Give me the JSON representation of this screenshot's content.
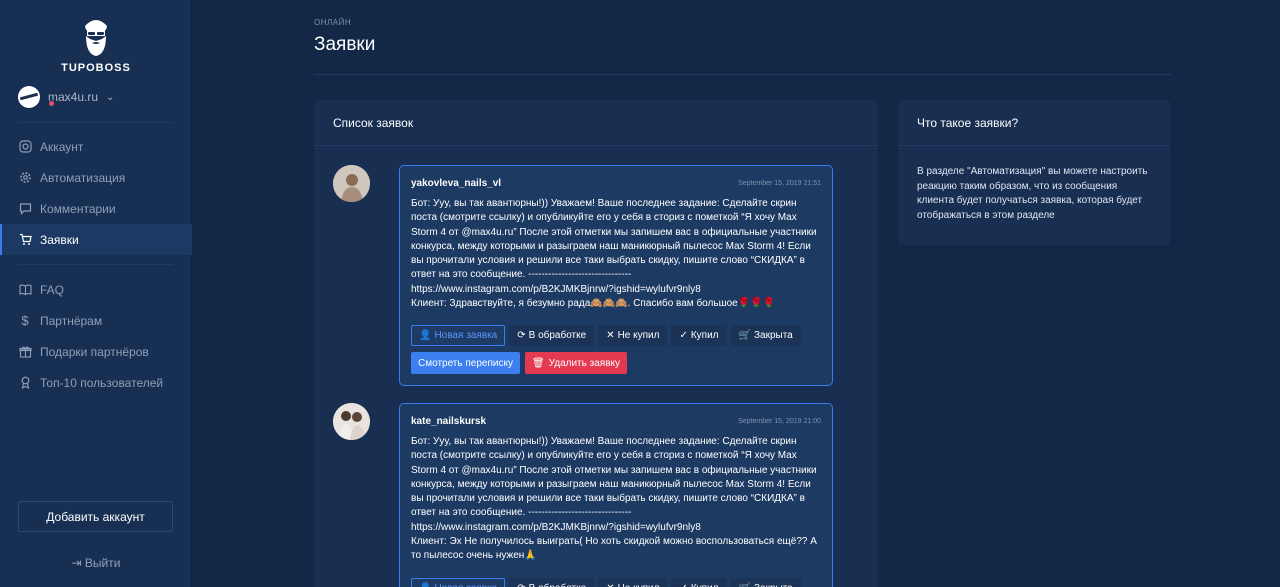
{
  "brand": {
    "name": "TUPOBOSS"
  },
  "account": {
    "name": "max4u.ru"
  },
  "nav": {
    "items": [
      {
        "label": "Аккаунт",
        "icon": "instagram-icon"
      },
      {
        "label": "Автоматизация",
        "icon": "gear-icon"
      },
      {
        "label": "Комментарии",
        "icon": "comment-icon"
      },
      {
        "label": "Заявки",
        "icon": "cart-icon",
        "active": true
      }
    ],
    "items2": [
      {
        "label": "FAQ",
        "icon": "book-icon"
      },
      {
        "label": "Партнёрам",
        "icon": "dollar-icon"
      },
      {
        "label": "Подарки партнёров",
        "icon": "gift-icon"
      },
      {
        "label": "Топ-10 пользователей",
        "icon": "award-icon"
      }
    ],
    "add_account": "Добавить аккаунт",
    "logout": "Выйти"
  },
  "page": {
    "pre_title": "ОНЛАЙН",
    "title": "Заявки"
  },
  "list": {
    "title": "Список заявок",
    "requests": [
      {
        "user": "yakovleva_nails_vl",
        "date": "September 15, 2019 21:51",
        "message": "Бот: Ууу, вы так авантюрны!)) Уважаем! Ваше последнее задание: Сделайте скрин поста (смотрите ссылку) и опубликуйте его у себя в сториз с пометкой “Я хочу Max Storm 4 от @max4u.ru” После этой отметки мы запишем вас в официальные участники конкурса, между которыми и разыграем наш маникюрный пылесос Max Storm 4! Если вы прочитали условия и решили все таки выбрать скидку, пишите слово “СКИДКА” в ответ на это сообщение. -------------------------------\nhttps://www.instagram.com/p/B2KJMKBjnrw/?igshid=wylufvr9nly8\nКлиент: Здравствуйте, я безумно рада🙈🙈🙈. Спасибо вам большое🌹🌹🌹"
      },
      {
        "user": "kate_nailskursk",
        "date": "September 15, 2019 21:00",
        "message": "Бот: Ууу, вы так авантюрны!)) Уважаем! Ваше последнее задание: Сделайте скрин поста (смотрите ссылку) и опубликуйте его у себя в сториз с пометкой “Я хочу Max Storm 4 от @max4u.ru” После этой отметки мы запишем вас в официальные участники конкурса, между которыми и разыграем наш маникюрный пылесос Max Storm 4! Если вы прочитали условия и решили все таки выбрать скидку, пишите слово “СКИДКА” в ответ на это сообщение. -------------------------------\nhttps://www.instagram.com/p/B2KJMKBjnrw/?igshid=wylufvr9nly8\nКлиент: Эх Не получилось выиграть( Но хоть скидкой можно воспользоваться ещё?? А то пылесос очень нужен🙏"
      }
    ],
    "statuses": {
      "new": "Новая заявка",
      "processing": "В обработке",
      "not_bought": "Не купил",
      "bought": "Купил",
      "closed": "Закрыта"
    },
    "actions": {
      "view": "Смотреть переписку",
      "delete": "Удалить заявку"
    }
  },
  "info": {
    "title": "Что такое заявки?",
    "text": "В разделе \"Автоматизация\" вы можете настроить реакцию таким образом, что из сообщения клиента будет получаться заявка, которая будет отображаться в этом разделе"
  },
  "colors": {
    "accent": "#3d7bf0",
    "danger": "#e33a52",
    "sidebar": "#172f52",
    "background": "#132847"
  }
}
